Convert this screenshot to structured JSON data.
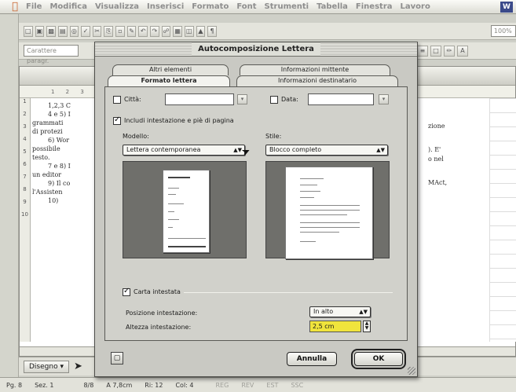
{
  "menubar": {
    "items": [
      "File",
      "Modifica",
      "Visualizza",
      "Inserisci",
      "Formato",
      "Font",
      "Strumenti",
      "Tabella",
      "Finestra",
      "Lavoro"
    ]
  },
  "toolbar": {
    "zoom_value": "100%",
    "style_value": "Carattere paragr."
  },
  "document": {
    "text_lines": [
      "1,2,3 C",
      "4 e 5) I",
      "grammati",
      "di protezi",
      "6) Wor",
      "possibile",
      "testo.",
      "7 e 8) I",
      "un editor",
      "9) Il co",
      "l'Assisten",
      "10)"
    ],
    "right_lines": [
      "zione",
      "). E'",
      "o nel",
      "MAct,"
    ]
  },
  "dialog": {
    "title": "Autocomposizione Lettera",
    "tabs_back": [
      "Altri elementi",
      "Informazioni mittente"
    ],
    "tabs_front": [
      "Formato lettera",
      "Informazioni destinatario"
    ],
    "city_label": "Città:",
    "date_label": "Data:",
    "include_header_label": "Includi intestazione e piè di pagina",
    "model_label": "Modello:",
    "model_value": "Lettera contemporanea",
    "style_label": "Stile:",
    "style_value": "Blocco completo",
    "letterhead_label": "Carta intestata",
    "header_position_label": "Posizione intestazione:",
    "header_position_value": "In alto",
    "header_height_label": "Altezza intestazione:",
    "header_height_value": "2,5 cm",
    "cancel_label": "Annulla",
    "ok_label": "OK"
  },
  "drawbar": {
    "draw_label": "Disegno"
  },
  "statusbar": {
    "page": "Pg. 8",
    "section": "Sez. 1",
    "page_count": "8/8",
    "position": "A 7,8cm",
    "line": "Ri: 12",
    "column": "Col: 4",
    "modes": [
      "REG",
      "REV",
      "EST",
      "SSC"
    ]
  },
  "icons": {
    "apple": "apple-menu-icon",
    "help": "help-icon"
  }
}
